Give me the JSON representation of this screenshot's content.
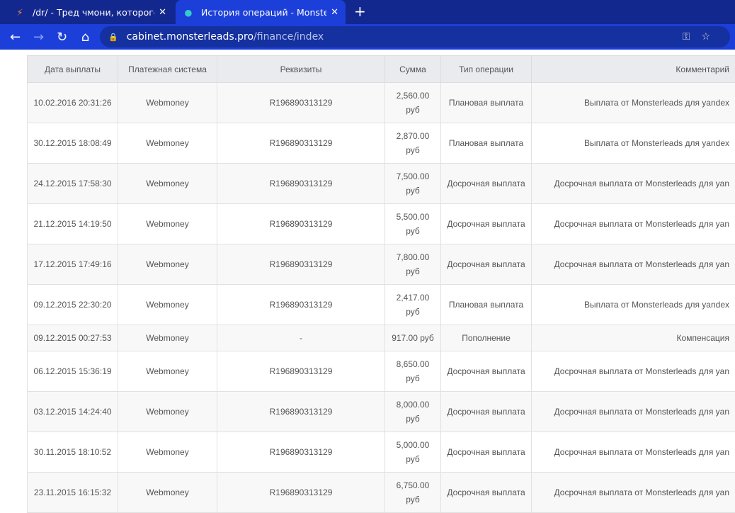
{
  "browser": {
    "tabs": [
      {
        "title": "/dr/ - Тред чмони, которого кинули",
        "icon": "lightning-icon",
        "active": false
      },
      {
        "title": "История операций - MonsterLeads",
        "icon": "monster-icon",
        "active": true
      }
    ],
    "url_host": "cabinet.monsterleads.pro",
    "url_path": "/finance/index"
  },
  "table": {
    "headers": [
      "Дата выплаты",
      "Платежная система",
      "Реквизиты",
      "Сумма",
      "Тип операции",
      "Комментарий"
    ],
    "rows": [
      [
        "10.02.2016 20:31:26",
        "Webmoney",
        "R196890313129",
        "2,560.00 руб",
        "Плановая выплата",
        "Выплата от Monsterleads для yandex"
      ],
      [
        "30.12.2015 18:08:49",
        "Webmoney",
        "R196890313129",
        "2,870.00 руб",
        "Плановая выплата",
        "Выплата от Monsterleads для yandex"
      ],
      [
        "24.12.2015 17:58:30",
        "Webmoney",
        "R196890313129",
        "7,500.00 руб",
        "Досрочная выплата",
        "Досрочная выплата от Monsterleads для yan"
      ],
      [
        "21.12.2015 14:19:50",
        "Webmoney",
        "R196890313129",
        "5,500.00 руб",
        "Досрочная выплата",
        "Досрочная выплата от Monsterleads для yan"
      ],
      [
        "17.12.2015 17:49:16",
        "Webmoney",
        "R196890313129",
        "7,800.00 руб",
        "Досрочная выплата",
        "Досрочная выплата от Monsterleads для yan"
      ],
      [
        "09.12.2015 22:30:20",
        "Webmoney",
        "R196890313129",
        "2,417.00 руб",
        "Плановая выплата",
        "Выплата от Monsterleads для yandex"
      ],
      [
        "09.12.2015 00:27:53",
        "Webmoney",
        "-",
        "917.00 руб",
        "Пополнение",
        "Компенсация"
      ],
      [
        "06.12.2015 15:36:19",
        "Webmoney",
        "R196890313129",
        "8,650.00 руб",
        "Досрочная выплата",
        "Досрочная выплата от Monsterleads для yan"
      ],
      [
        "03.12.2015 14:24:40",
        "Webmoney",
        "R196890313129",
        "8,000.00 руб",
        "Досрочная выплата",
        "Досрочная выплата от Monsterleads для yan"
      ],
      [
        "30.11.2015 18:10:52",
        "Webmoney",
        "R196890313129",
        "5,000.00 руб",
        "Досрочная выплата",
        "Досрочная выплата от Monsterleads для yan"
      ],
      [
        "23.11.2015 16:15:32",
        "Webmoney",
        "R196890313129",
        "6,750.00 руб",
        "Досрочная выплата",
        "Досрочная выплата от Monsterleads для yan"
      ]
    ]
  }
}
